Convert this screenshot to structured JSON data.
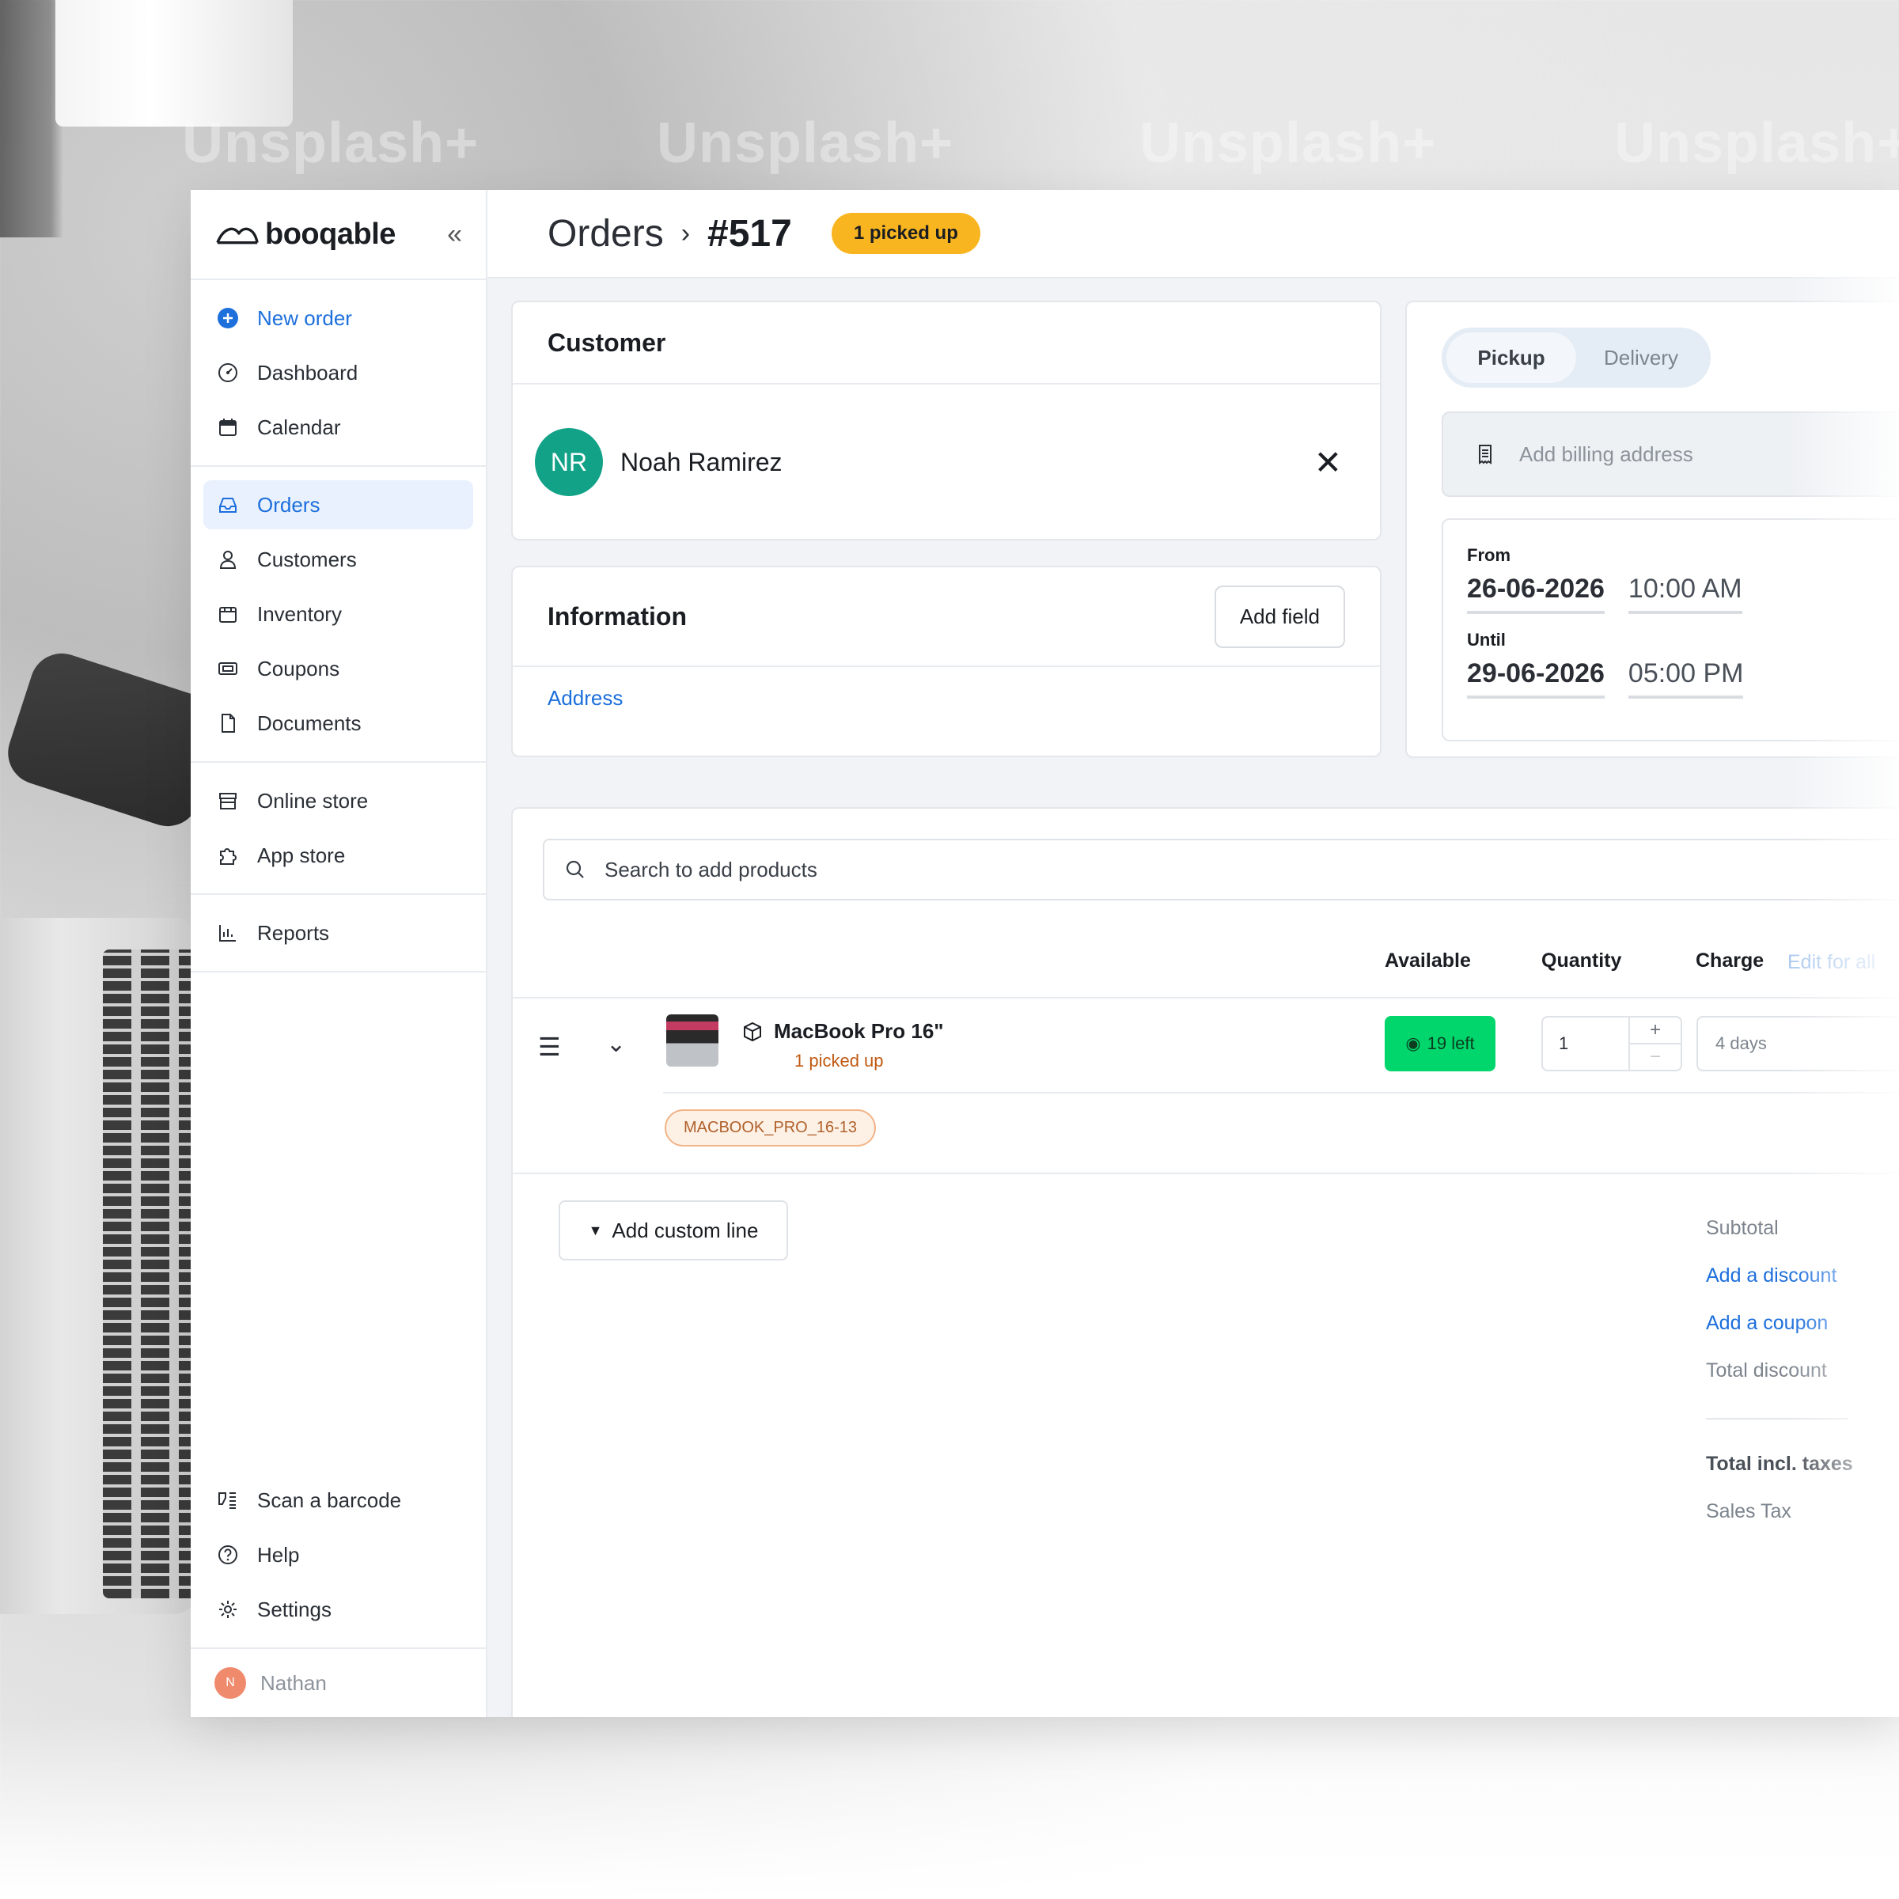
{
  "watermark": "Unsplash+",
  "sidebar": {
    "logo": "booqable",
    "new_order": "New order",
    "items": [
      "Dashboard",
      "Calendar",
      "Orders",
      "Customers",
      "Inventory",
      "Coupons",
      "Documents",
      "Online store",
      "App store",
      "Reports"
    ],
    "bottom_items": [
      "Scan a barcode",
      "Help",
      "Settings"
    ],
    "user": {
      "initial": "N",
      "name": "Nathan"
    }
  },
  "header": {
    "section": "Orders",
    "order_number": "#517",
    "status": "1 picked up"
  },
  "customer": {
    "title": "Customer",
    "initials": "NR",
    "name": "Noah Ramirez"
  },
  "information": {
    "title": "Information",
    "add_field": "Add field",
    "address_link": "Address"
  },
  "fulfillment": {
    "options": [
      "Pickup",
      "Delivery"
    ],
    "selected": "Pickup",
    "billing_placeholder": "Add billing address",
    "from_label": "From",
    "from_date": "26-06-2026",
    "from_time": "10:00 AM",
    "until_label": "Until",
    "until_date": "29-06-2026",
    "until_time": "05:00 PM"
  },
  "products": {
    "search_placeholder": "Search to add products",
    "columns": {
      "available": "Available",
      "quantity": "Quantity",
      "charge": "Charge",
      "edit_all": "Edit for all"
    },
    "line": {
      "name": "MacBook Pro 16\"",
      "status": "1 picked up",
      "available": "19 left",
      "quantity": "1",
      "charge": "4 days",
      "sku": "MACBOOK_PRO_16-13"
    },
    "add_custom_line": "Add custom line"
  },
  "totals": {
    "subtotal": "Subtotal",
    "add_discount": "Add a discount",
    "add_coupon": "Add a coupon",
    "total_discount": "Total discount",
    "total_incl_taxes": "Total incl. taxes",
    "sales_tax": "Sales Tax"
  },
  "colors": {
    "accent": "#1d6fdc",
    "status_pill": "#f8b520",
    "available_badge": "#00d66b",
    "customer_avatar": "#11a287",
    "user_avatar": "#f08a6c"
  }
}
